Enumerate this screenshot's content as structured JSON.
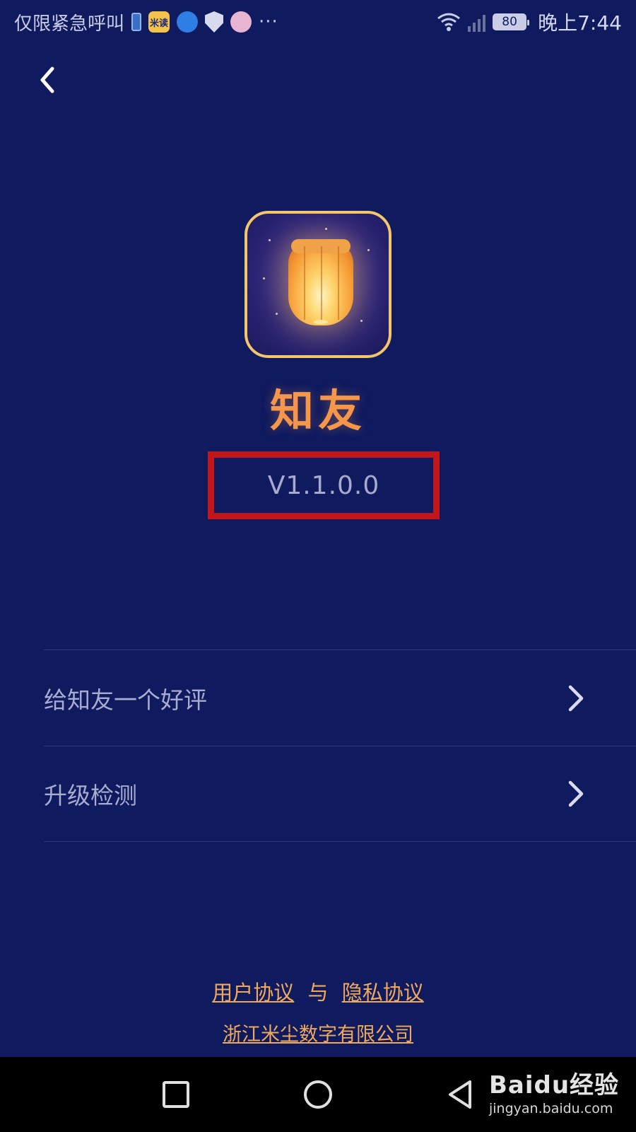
{
  "status_bar": {
    "carrier_text": "仅限紧急呼叫",
    "battery_level": "80",
    "time": "晚上7:44",
    "more_indicator": "···",
    "notification_icons": [
      "battery-saver-icon",
      "mi-app-icon",
      "browser-globe-icon",
      "security-shield-icon",
      "pink-app-icon"
    ],
    "mi_icon_text": "米读"
  },
  "header": {
    "back_icon": "chevron-left-icon"
  },
  "app": {
    "name": "知友",
    "version": "V1.1.0.0",
    "icon": "sky-lantern-app-icon"
  },
  "menu": {
    "items": [
      {
        "label": "给知友一个好评",
        "icon": "chevron-right-icon"
      },
      {
        "label": "升级检测",
        "icon": "chevron-right-icon"
      }
    ]
  },
  "footer": {
    "user_agreement": "用户协议",
    "separator": "与",
    "privacy_agreement": "隐私协议",
    "company": "浙江米尘数字有限公司"
  },
  "nav_bar": {
    "buttons": [
      "recent-apps-icon",
      "home-icon",
      "back-triangle-icon"
    ]
  },
  "watermark": {
    "brand": "Baidu经验",
    "url": "jingyan.baidu.com"
  },
  "colors": {
    "background": "#0f1a5f",
    "accent_orange": "#f5964a",
    "link_orange": "#f0a95a",
    "highlight_red": "#c1161a"
  }
}
